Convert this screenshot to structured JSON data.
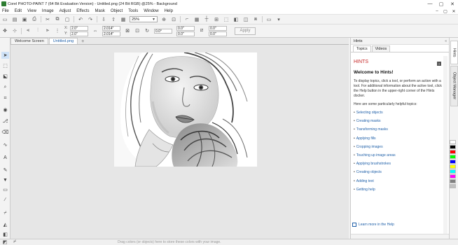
{
  "window": {
    "title": "Corel PHOTO-PAINT 7 (64 Bit Evaluation Version) - Untitled.png (24 Bit RGB) @25% - Background",
    "controls": [
      "—",
      "▢",
      "✕"
    ]
  },
  "menu": [
    "File",
    "Edit",
    "View",
    "Image",
    "Adjust",
    "Effects",
    "Mask",
    "Object",
    "Tools",
    "Window",
    "Help"
  ],
  "mdi_controls": [
    "–",
    "▢",
    "✕"
  ],
  "toolbar": {
    "zoom": "25%",
    "icons": [
      "new-icon",
      "open-icon",
      "save-icon",
      "print-icon",
      "cut-icon",
      "copy-icon",
      "paste-icon",
      "undo-icon",
      "redo-icon",
      "import-icon",
      "export-icon"
    ]
  },
  "property_bar": {
    "x": "X:",
    "y": "Y:",
    "x_val": "2.0\"",
    "y_val": "2.0\"",
    "w_val": "2.014\"",
    "h_val": "2.014\"",
    "rot_val": "0.0°",
    "cx_val": "0.0\"",
    "cy_val": "0.0\"",
    "sx_val": "0.0\"",
    "sy_val": "0.0\"",
    "apply_label": "Apply"
  },
  "doc_tabs": [
    {
      "label": "Welcome Screen",
      "active": false
    },
    {
      "label": "Untitled.png",
      "active": true
    }
  ],
  "statusbar": {
    "hint": "Drag colors (or objects) here to store these colors with your image."
  },
  "hints_docker": {
    "header": "Hints",
    "tabs": [
      "Topics",
      "Videos"
    ],
    "section_title": "HINTS",
    "welcome": "Welcome to Hints!",
    "intro": "To display topics, click a tool, or perform an action with a tool. For additional information about the active tool, click the Help button in the upper-right corner of the Hints docker.",
    "subheading": "Here are some particularly helpful topics:",
    "topics": [
      "Selecting objects",
      "Creating masks",
      "Transforming masks",
      "Applying fills",
      "Cropping images",
      "Touching up image areas",
      "Applying brushstrokes",
      "Creating objects",
      "Adding text",
      "Getting help"
    ],
    "learn_more": "Learn more in the Help"
  },
  "side_tabs": [
    "Hints",
    "Object Manager"
  ],
  "colors": {
    "accent": "#1e5fa8",
    "hints_red": "#c62828",
    "palette": [
      "#ffffff",
      "#000000",
      "#ff0000",
      "#00ff00",
      "#0000ff",
      "#ffff00",
      "#00ffff",
      "#ff00ff",
      "#808080",
      "#c0c0c0"
    ]
  }
}
